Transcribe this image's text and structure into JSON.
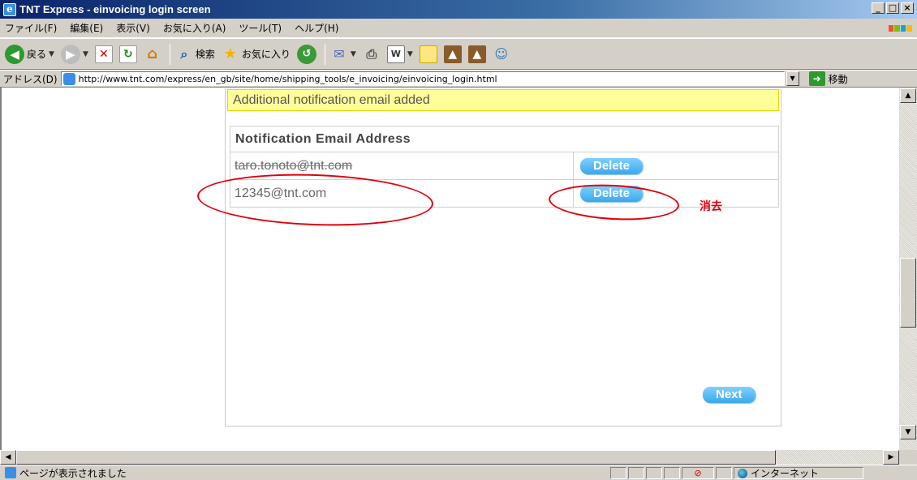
{
  "window": {
    "title": "TNT Express - einvoicing login screen",
    "controls": [
      "_",
      "□",
      "×"
    ]
  },
  "menu": [
    "ファイル(F)",
    "編集(E)",
    "表示(V)",
    "お気に入り(A)",
    "ツール(T)",
    "ヘルプ(H)"
  ],
  "toolbar": {
    "back": "戻る",
    "search": "検索",
    "favorites": "お気に入り"
  },
  "address": {
    "label": "アドレス(D)",
    "url": "http://www.tnt.com/express/en_gb/site/home/shipping_tools/e_invoicing/einvoicing_login.html",
    "go": "移動"
  },
  "page": {
    "notification": "Additional notification email added",
    "table_header": "Notification Email Address",
    "rows": [
      {
        "email": "taro.tonoto@tnt.com",
        "action": "Delete"
      },
      {
        "email": "12345@tnt.com",
        "action": "Delete"
      }
    ],
    "next": "Next"
  },
  "annotation": {
    "label": "消去",
    "color": "#e0000b"
  },
  "status": {
    "text": "ページが表示されました",
    "zone": "インターネット"
  }
}
